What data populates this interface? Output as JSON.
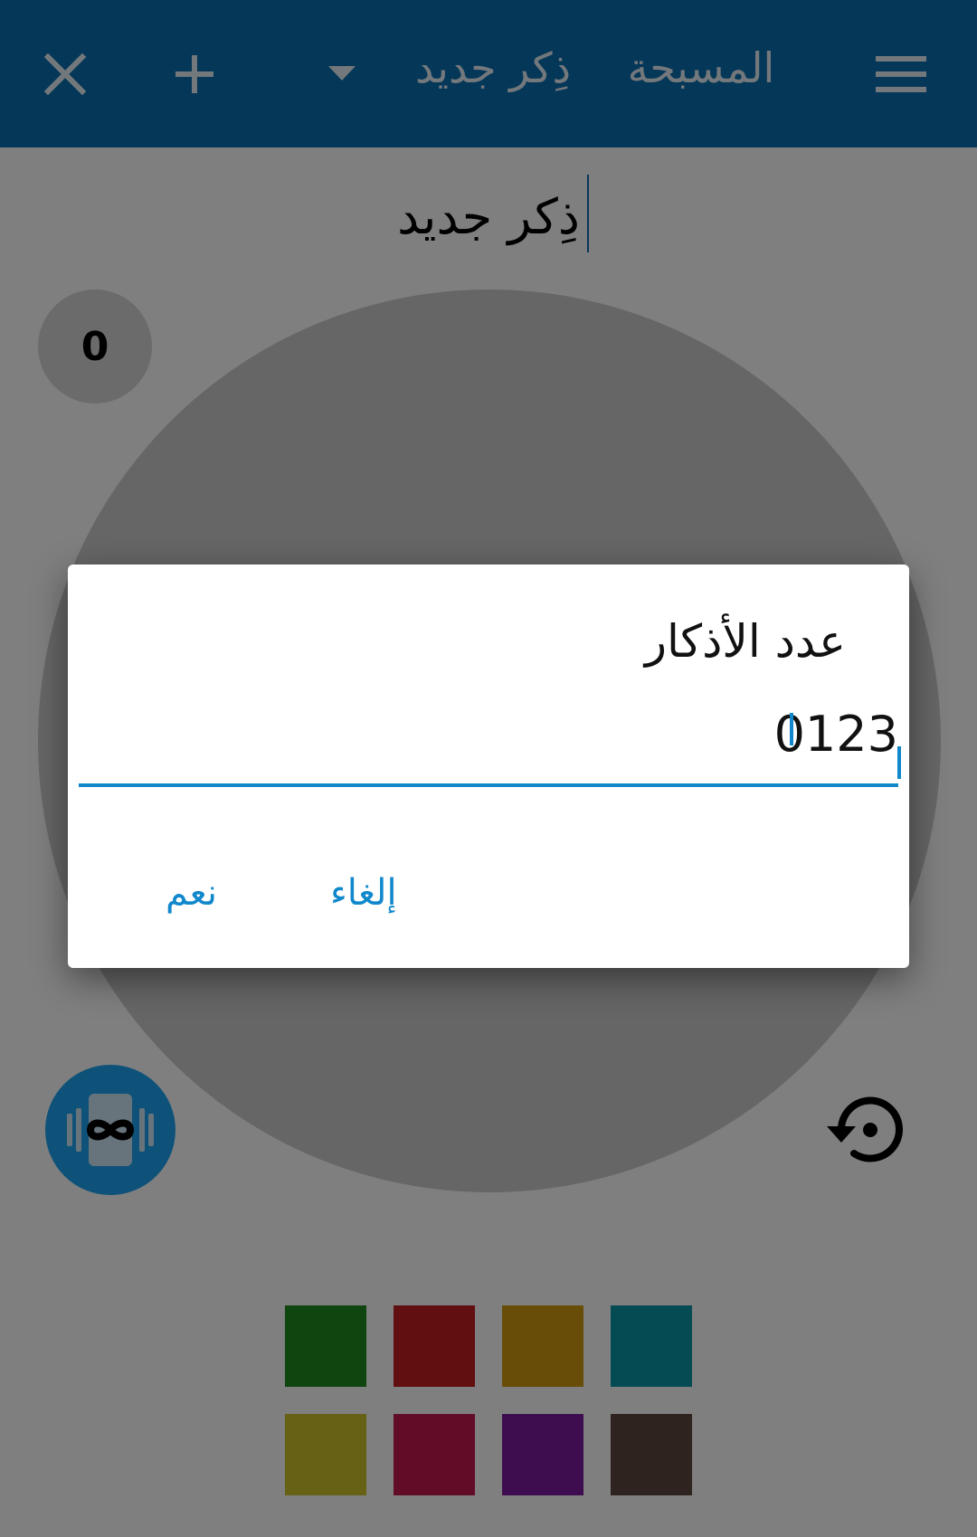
{
  "appbar": {
    "title": "المسبحة",
    "dhikr_selector": "ذِكر جديد",
    "menu_icon": "menu-icon",
    "dropdown_icon": "triangle-down-icon",
    "add_icon": "plus-icon",
    "close_icon": "close-icon"
  },
  "main": {
    "dhikr_title": "ذِكر جديد",
    "count": "0",
    "vibrate_icon": "vibrate-infinity-icon",
    "reset_icon": "restore-icon"
  },
  "swatches": [
    {
      "color": "#1f8a1f"
    },
    {
      "color": "#c41e24"
    },
    {
      "color": "#cf9b0f"
    },
    {
      "color": "#0b97a8"
    },
    {
      "color": "#cfc32a"
    },
    {
      "color": "#c41b4f"
    },
    {
      "color": "#7b1aa0"
    },
    {
      "color": "#5e463e"
    }
  ],
  "dialog": {
    "title": "عدد الأذكار",
    "input_value": "0123",
    "cancel_label": "إلغاء",
    "ok_label": "نعم"
  },
  "colors": {
    "primary": "#0a6fb0",
    "accent": "#1ea5f2",
    "dialog_accent": "#1188cc"
  }
}
